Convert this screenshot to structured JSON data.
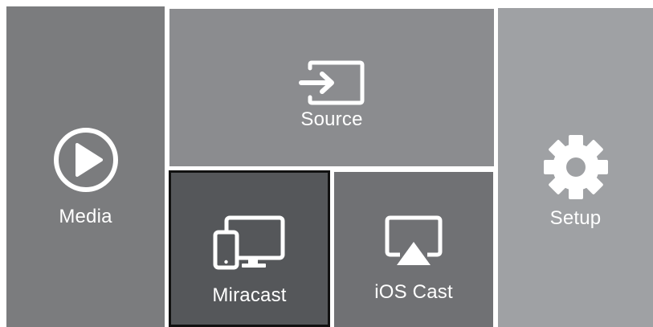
{
  "tiles": {
    "media": {
      "label": "Media",
      "icon": "play-circle-icon"
    },
    "source": {
      "label": "Source",
      "icon": "input-source-icon"
    },
    "miracast": {
      "label": "Miracast",
      "icon": "devices-icon",
      "selected": true
    },
    "ios_cast": {
      "label": "iOS Cast",
      "icon": "airplay-icon"
    },
    "setup": {
      "label": "Setup",
      "icon": "gear-icon"
    }
  },
  "colors": {
    "background": "#ffffff",
    "media_tile": "#7b7c7e",
    "source_tile": "#8b8c8f",
    "miracast_tile": "#55575a",
    "ios_cast_tile": "#707174",
    "setup_tile": "#9fa1a4",
    "focus_border": "#111111",
    "foreground": "#ffffff"
  }
}
